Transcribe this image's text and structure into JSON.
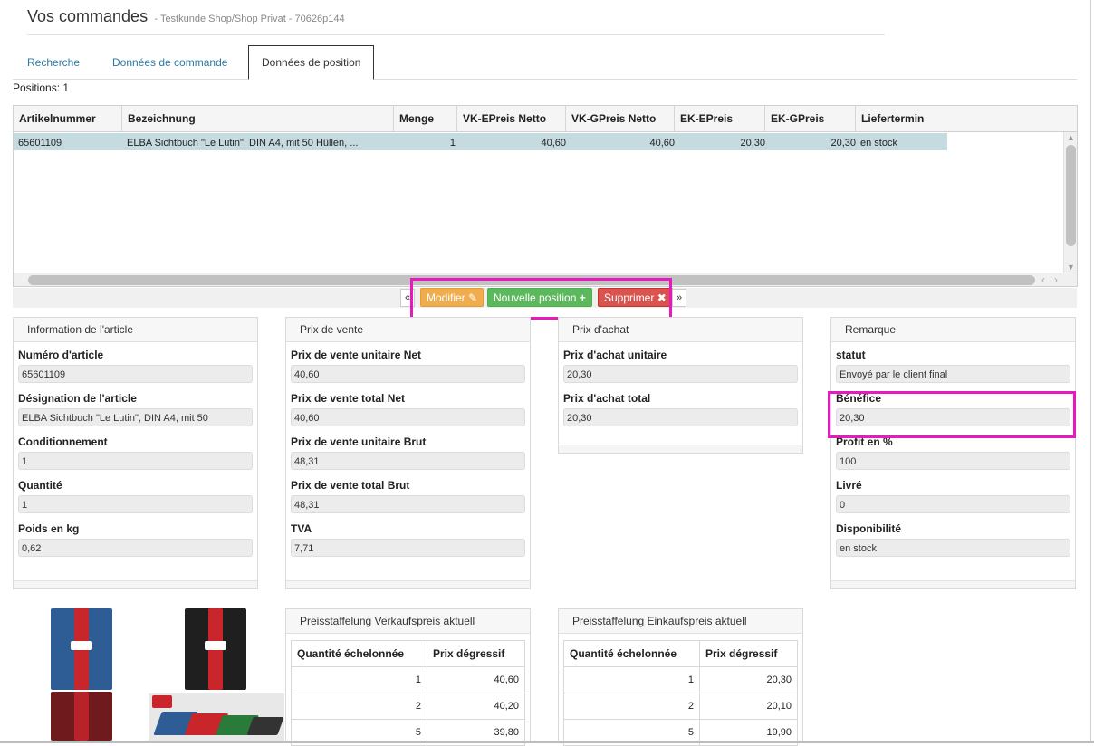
{
  "header": {
    "title": "Vos commandes",
    "subtitle": "- Testkunde Shop/Shop Privat - 70626p144"
  },
  "tabs": [
    {
      "label": "Recherche"
    },
    {
      "label": "Données de commande"
    },
    {
      "label": "Données de position"
    }
  ],
  "positions_label": "Positions: 1",
  "grid": {
    "columns": [
      "Artikelnummer",
      "Bezeichnung",
      "Menge",
      "VK-EPreis Netto",
      "VK-GPreis Netto",
      "EK-EPreis",
      "EK-GPreis",
      "Liefertermin"
    ],
    "row": {
      "artikelnummer": "65601109",
      "bezeichnung": "ELBA Sichtbuch \"Le Lutin\", DIN A4, mit 50 Hüllen, ...",
      "menge": "1",
      "vk_epreis": "40,60",
      "vk_gpreis": "40,60",
      "ek_epreis": "20,30",
      "ek_gpreis": "20,30",
      "liefertermin": "en stock"
    }
  },
  "actions": {
    "prev": "«",
    "modifier": "Modifier",
    "nouvelle": "Nouvelle position",
    "supprimer": "Supprimer",
    "next": "»"
  },
  "panels": {
    "article": {
      "title": "Information de l'article",
      "fields": [
        {
          "label": "Numéro d'article",
          "value": "65601109"
        },
        {
          "label": "Désignation de l'article",
          "value": "ELBA Sichtbuch \"Le Lutin\", DIN A4, mit 50"
        },
        {
          "label": "Conditionnement",
          "value": "1"
        },
        {
          "label": "Quantité",
          "value": "1"
        },
        {
          "label": "Poids en kg",
          "value": "0,62"
        }
      ]
    },
    "vente": {
      "title": "Prix de vente",
      "fields": [
        {
          "label": "Prix de vente unitaire Net",
          "value": "40,60"
        },
        {
          "label": "Prix de vente total Net",
          "value": "40,60"
        },
        {
          "label": "Prix de vente unitaire Brut",
          "value": "48,31"
        },
        {
          "label": "Prix de vente total Brut",
          "value": "48,31"
        },
        {
          "label": "TVA",
          "value": "7,71"
        }
      ]
    },
    "achat": {
      "title": "Prix d'achat",
      "fields": [
        {
          "label": "Prix d'achat unitaire",
          "value": "20,30"
        },
        {
          "label": "Prix d'achat total",
          "value": "20,30"
        }
      ]
    },
    "remarque": {
      "title": "Remarque",
      "fields": [
        {
          "label": "statut",
          "value": "Envoyé par le client final"
        },
        {
          "label": "Bénéfice",
          "value": "20,30"
        },
        {
          "label": "Profit en %",
          "value": "100"
        },
        {
          "label": "Livré",
          "value": "0"
        },
        {
          "label": "Disponibilité",
          "value": "en stock"
        }
      ]
    }
  },
  "price_sale": {
    "title": "Preisstaffelung Verkaufspreis aktuell",
    "headers": [
      "Quantité échelonnée",
      "Prix dégressif"
    ],
    "rows": [
      [
        "1",
        "40,60"
      ],
      [
        "2",
        "40,20"
      ],
      [
        "5",
        "39,80"
      ]
    ]
  },
  "price_buy": {
    "title": "Preisstaffelung Einkaufspreis aktuell",
    "headers": [
      "Quantité échelonnée",
      "Prix dégressif"
    ],
    "rows": [
      [
        "1",
        "20,30"
      ],
      [
        "2",
        "20,10"
      ],
      [
        "5",
        "19,90"
      ]
    ]
  },
  "colors": {
    "highlight": "#e51bbd",
    "row_selected": "#c6dbe0",
    "btn_modifier": "#f0ad4e",
    "btn_nouvelle": "#5cb85c",
    "btn_supprimer": "#d9534f",
    "tab_link": "#2a7aa0"
  },
  "icons": {
    "modifier": "edit-icon",
    "nouvelle": "plus-icon",
    "supprimer": "close-icon"
  }
}
